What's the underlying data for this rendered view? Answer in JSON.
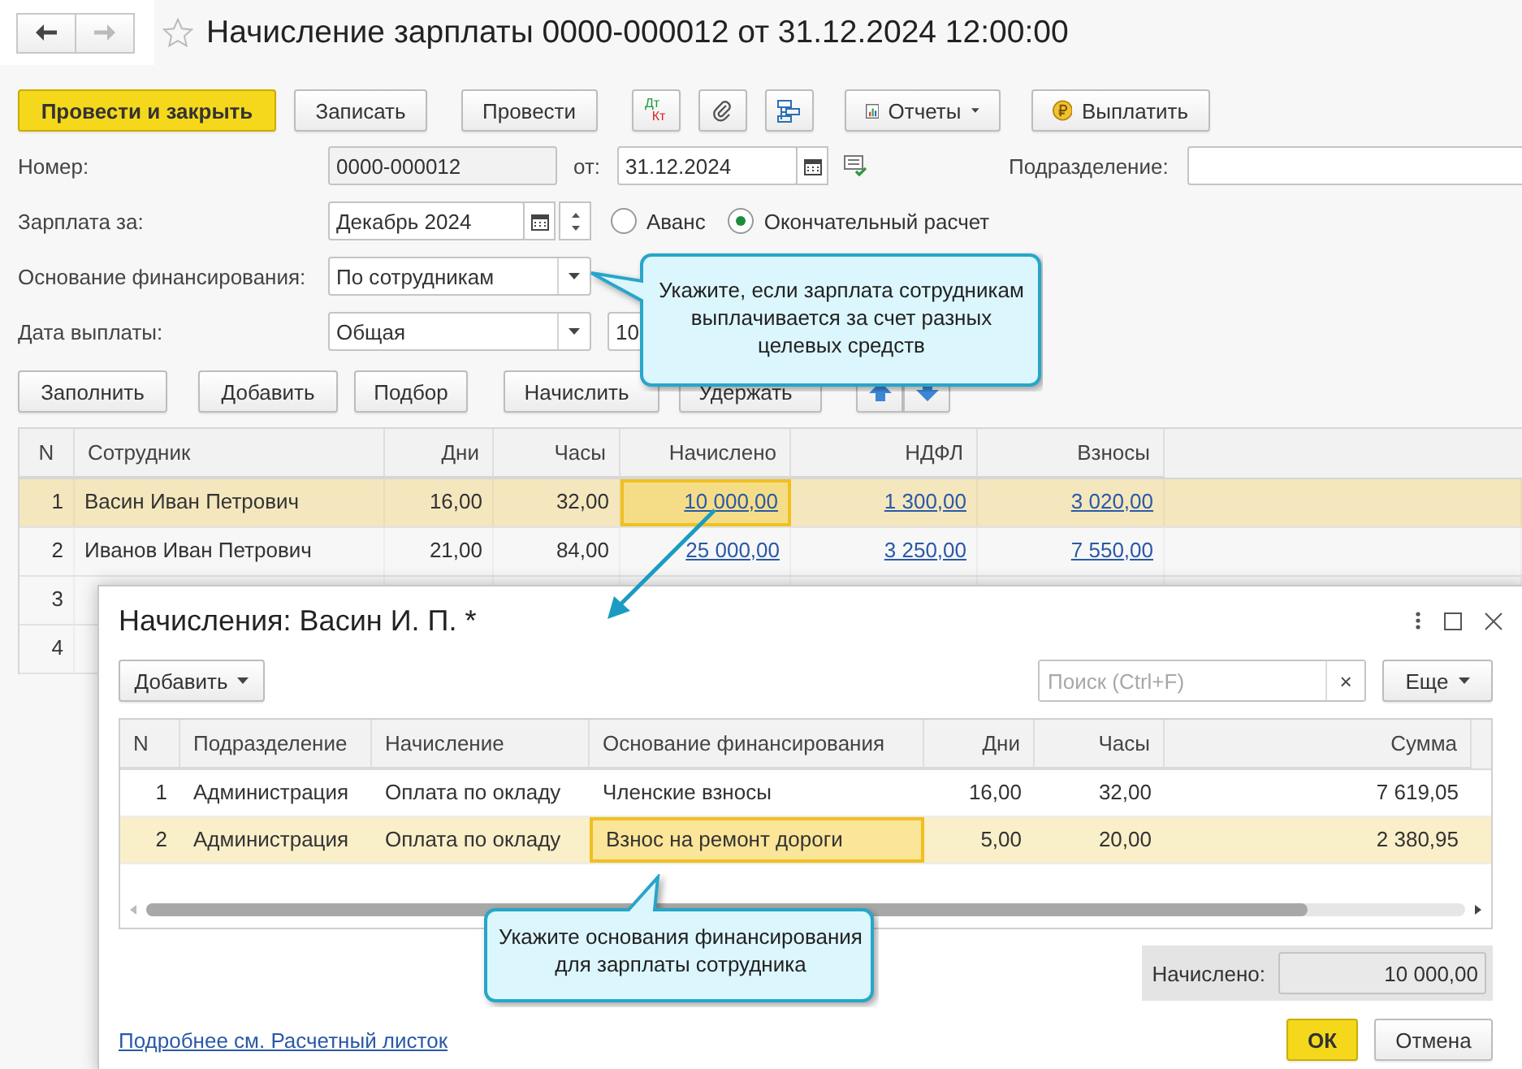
{
  "nav": {
    "back_enabled": true,
    "forward_enabled": false
  },
  "title": "Начисление зарплаты 0000-000012 от 31.12.2024 12:00:00",
  "toolbar": [
    {
      "kind": "primary",
      "label": "Провести и закрыть"
    },
    {
      "kind": "button",
      "label": "Записать"
    },
    {
      "kind": "button",
      "label": "Провести"
    },
    {
      "kind": "dtkt",
      "top": "Дт",
      "bottom": "Кт"
    },
    {
      "kind": "attach"
    },
    {
      "kind": "structure"
    },
    {
      "kind": "report-menu",
      "label": "Отчеты"
    },
    {
      "kind": "pay",
      "label": "Выплатить"
    }
  ],
  "number": {
    "label": "Номер:",
    "value": "0000-000012"
  },
  "date": {
    "label": "от:",
    "value": "31.12.2024"
  },
  "department": {
    "label": "Подразделение:"
  },
  "salary_for": {
    "label": "Зарплата за:",
    "value": "Декабрь 2024"
  },
  "payment_type": [
    {
      "label": "Аванс",
      "selected": false
    },
    {
      "label": "Окончательный расчет",
      "selected": true
    }
  ],
  "funding": {
    "label": "Основание финансирования:",
    "value": "По сотрудникам"
  },
  "payment_date": {
    "label": "Дата выплаты:",
    "value": "Общая",
    "date_value": "10"
  },
  "table_buttons": [
    {
      "kind": "button",
      "label": "Заполнить"
    },
    {
      "kind": "button",
      "label": "Добавить"
    },
    {
      "kind": "button",
      "label": "Подбор"
    },
    {
      "kind": "menu",
      "label": "Начислить"
    },
    {
      "kind": "menu",
      "label": "Удержать"
    },
    {
      "kind": "move-up"
    },
    {
      "kind": "move-down"
    }
  ],
  "table": {
    "columns": [
      "N",
      "Сотрудник",
      "Дни",
      "Часы",
      "Начислено",
      "НДФЛ",
      "Взносы"
    ],
    "rows": [
      {
        "n": "1",
        "employee": "Васин Иван Петрович",
        "days": "16,00",
        "hours": "32,00",
        "accrued": "10 000,00",
        "ndfl": "1 300,00",
        "contributions": "3 020,00",
        "selected": true,
        "accrued_focused": true
      },
      {
        "n": "2",
        "employee": "Иванов Иван Петрович",
        "days": "21,00",
        "hours": "84,00",
        "accrued": "25 000,00",
        "ndfl": "3 250,00",
        "contributions": "7 550,00",
        "selected": false,
        "accrued_focused": false
      },
      {
        "n": "3",
        "selected": false
      },
      {
        "n": "4",
        "selected": false
      }
    ]
  },
  "hint_top": {
    "text": "Укажите, если зарплата сотрудникам выплачивается за счет разных целевых средств"
  },
  "dialog": {
    "title": "Начисления: Васин И. П. *",
    "add_button": "Добавить",
    "search": {
      "placeholder": "Поиск (Ctrl+F)",
      "clear": "×"
    },
    "more_button": "Еще",
    "table": {
      "columns": [
        "N",
        "Подразделение",
        "Начисление",
        "Основание финансирования",
        "Дни",
        "Часы",
        "Сумма"
      ],
      "rows": [
        {
          "n": "1",
          "department": "Администрация",
          "accrual": "Оплата по окладу",
          "basis": "Членские взносы",
          "days": "16,00",
          "hours": "32,00",
          "amount": "7 619,05",
          "selected": false,
          "basis_focused": false
        },
        {
          "n": "2",
          "department": "Администрация",
          "accrual": "Оплата по окладу",
          "basis": "Взнос на ремонт дороги",
          "days": "5,00",
          "hours": "20,00",
          "amount": "2 380,95",
          "selected": true,
          "basis_focused": true
        }
      ]
    },
    "total": {
      "label": "Начислено:",
      "value": "10 000,00"
    },
    "link": "Подробнее см. Расчетный листок",
    "ok_button": "ОК",
    "cancel_button": "Отмена"
  },
  "hint_bottom": {
    "text": "Укажите основания финансирования для зарплаты сотрудника"
  }
}
